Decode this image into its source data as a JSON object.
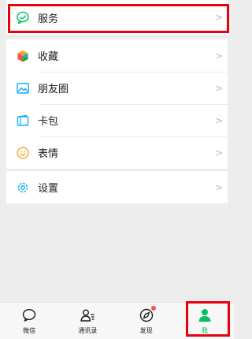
{
  "menu": {
    "service": {
      "label": "服务",
      "icon": "service-icon",
      "color": "#07c160"
    },
    "items": [
      {
        "label": "收藏",
        "icon": "favorites-cube-icon"
      },
      {
        "label": "朋友圈",
        "icon": "moments-photo-icon"
      },
      {
        "label": "卡包",
        "icon": "card-wallet-icon"
      },
      {
        "label": "表情",
        "icon": "emoji-smile-icon"
      }
    ],
    "settings": {
      "label": "设置",
      "icon": "gear-icon"
    }
  },
  "tabbar": {
    "tabs": [
      {
        "label": "微信",
        "icon": "chat-bubble-icon"
      },
      {
        "label": "通讯录",
        "icon": "contacts-icon"
      },
      {
        "label": "发现",
        "icon": "compass-icon",
        "badge": "red-dot"
      },
      {
        "label": "我",
        "icon": "person-icon",
        "active": true,
        "color": "#07c160"
      }
    ]
  },
  "annotation_color": "#e8000b"
}
